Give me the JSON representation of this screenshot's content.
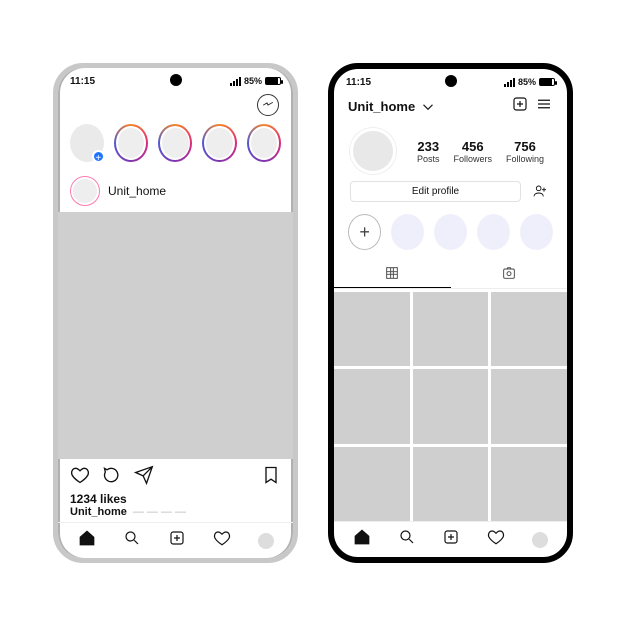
{
  "status": {
    "time": "11:15",
    "battery_pct": "85%"
  },
  "feed": {
    "username": "Unit_home",
    "likes_line": "1234 likes",
    "caption_placeholder": "— — — —"
  },
  "profile": {
    "handle": "Unit_home",
    "stats": {
      "posts": {
        "count": "233",
        "label": "Posts"
      },
      "followers": {
        "count": "456",
        "label": "Followers"
      },
      "following": {
        "count": "756",
        "label": "Following"
      }
    },
    "edit_label": "Edit profile"
  }
}
